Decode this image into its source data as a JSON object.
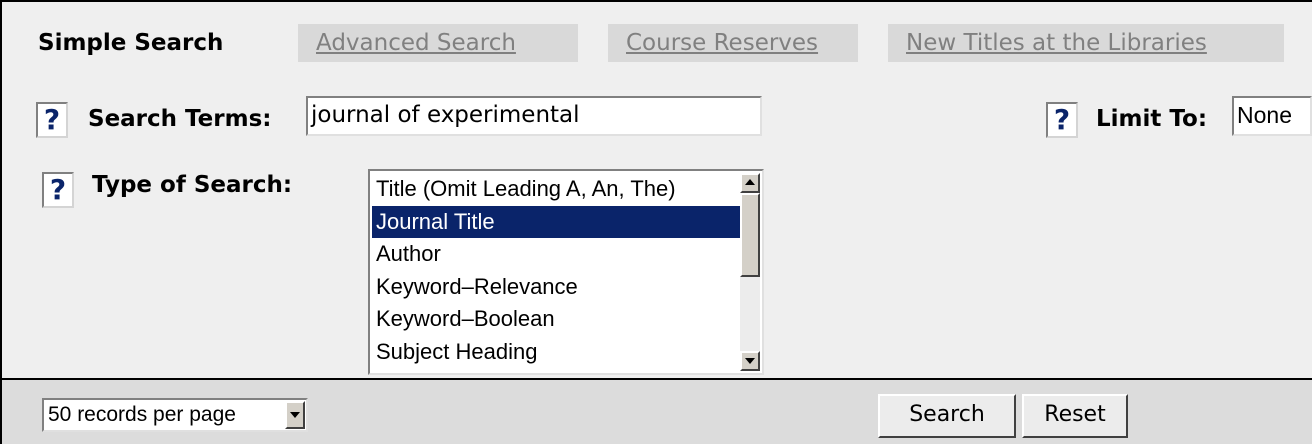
{
  "tabs": {
    "simple": "Simple Search",
    "advanced": "Advanced Search",
    "course": "Course Reserves",
    "new_titles": "New Titles at the Libraries"
  },
  "help_icon": "?",
  "search_terms": {
    "label": "Search Terms:",
    "value": "journal of experimental"
  },
  "limit_to": {
    "label": "Limit To:",
    "value": "None"
  },
  "type_of_search": {
    "label": "Type of Search:",
    "options": [
      "Title (Omit Leading A, An, The)",
      "Journal Title",
      "Author",
      "Keyword–Relevance",
      "Keyword–Boolean",
      "Subject Heading"
    ],
    "selected": "Journal Title"
  },
  "records_per_page": "50 records per page",
  "buttons": {
    "search": "Search",
    "reset": "Reset"
  },
  "colors": {
    "selection": "#0a246a",
    "help_glyph": "#0a246a"
  }
}
